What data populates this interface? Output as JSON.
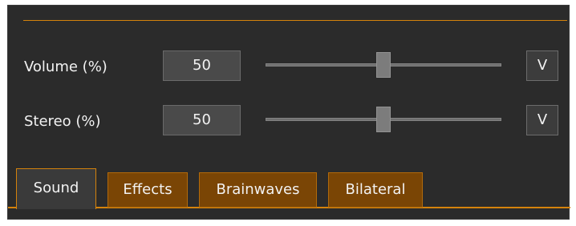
{
  "controls": [
    {
      "label": "Volume (%)",
      "value": "50",
      "slider_fraction": 0.5,
      "button_label": "V"
    },
    {
      "label": "Stereo (%)",
      "value": "50",
      "slider_fraction": 0.5,
      "button_label": "V"
    }
  ],
  "tabs": [
    {
      "label": "Sound",
      "active": true
    },
    {
      "label": "Effects",
      "active": false
    },
    {
      "label": "Brainwaves",
      "active": false
    },
    {
      "label": "Bilateral",
      "active": false
    }
  ],
  "colors": {
    "accent": "#d4820c",
    "panel_background": "#2b2b2b",
    "inactive_tab": "#7a4505"
  }
}
